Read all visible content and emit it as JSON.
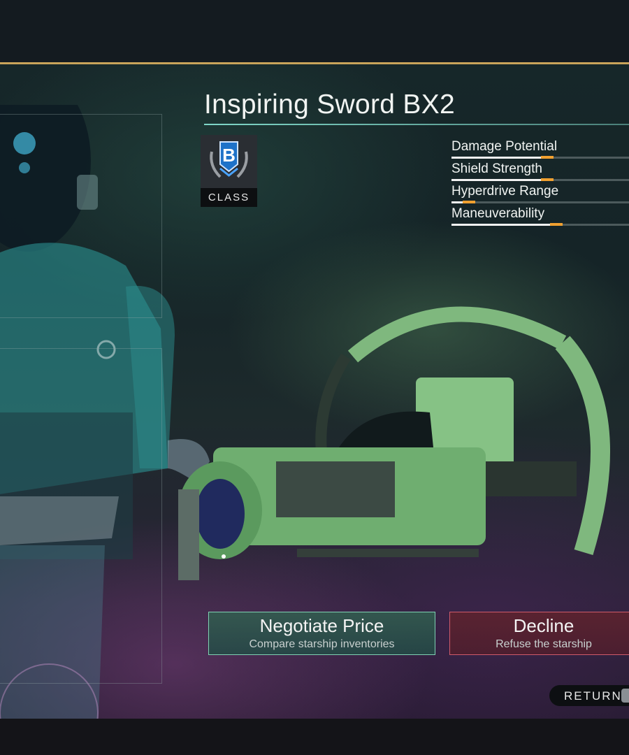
{
  "ship": {
    "name": "Inspiring Sword BX2",
    "class_letter": "B",
    "class_label": "CLASS"
  },
  "stats": [
    {
      "label": "Damage Potential",
      "level": 0.52
    },
    {
      "label": "Shield Strength",
      "level": 0.52
    },
    {
      "label": "Hyperdrive Range",
      "level": 0.08
    },
    {
      "label": "Maneuverability",
      "level": 0.57
    }
  ],
  "actions": {
    "negotiate": {
      "title": "Negotiate Price",
      "subtitle": "Compare starship inventories"
    },
    "decline": {
      "title": "Decline",
      "subtitle": "Refuse the starship"
    }
  },
  "return_label": "RETURN",
  "colors": {
    "accent_gold": "#c9a45a",
    "accent_teal": "#7fd7c8",
    "stat_tip": "#f0a030",
    "negotiate_border": "#7fd2b3",
    "decline_border": "#d05a6a",
    "ship_green": "#7fb87e"
  },
  "icons": {
    "class_emblem": "laurel-shield-icon",
    "return_key": "keyboard-key-icon"
  }
}
